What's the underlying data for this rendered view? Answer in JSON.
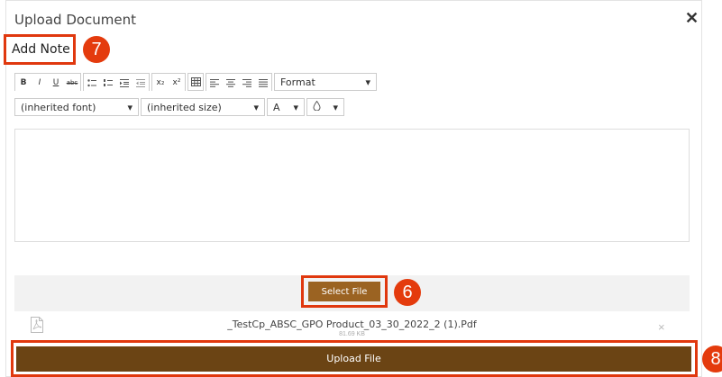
{
  "dialog": {
    "title": "Upload Document",
    "close_symbol": "✕"
  },
  "note": {
    "label": "Add Note"
  },
  "callouts": {
    "c7": "7",
    "c6": "6",
    "c8": "8"
  },
  "toolbar": {
    "bold": "B",
    "italic": "I",
    "underline": "U",
    "strike": "abc",
    "subscript": "x₂",
    "superscript": "x²",
    "format_label": "Format",
    "font_label": "(inherited font)",
    "size_label": "(inherited size)",
    "font_color": "A"
  },
  "upload": {
    "select_file_label": "Select File",
    "file_name": "_TestCp_ABSC_GPO Product_03_30_2022_2 (1).Pdf",
    "file_size": "81.69 KB",
    "remove_symbol": "×",
    "upload_label": "Upload File"
  },
  "colors": {
    "accent_callout": "#e43b0d",
    "select_button": "#9b6322",
    "upload_button": "#6b4414"
  }
}
